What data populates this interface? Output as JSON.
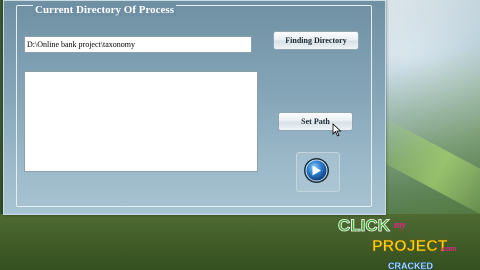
{
  "window": {
    "group_title": "Current Directory Of Process",
    "path_value": "D:\\Online bank project\\taxonomy",
    "find_button_label": "Finding Directory",
    "set_path_button_label": "Set Path",
    "output_text": ""
  },
  "logo": {
    "line1": "CLICK",
    "line1_small": "my",
    "line2": "PROJECT",
    "line2_small": ".com",
    "line3": "CRACKED"
  },
  "colors": {
    "logo_green": "#3aa12a",
    "logo_pink": "#e0268a",
    "logo_yellow": "#f2d21a",
    "arrow_blue": "#1b6fbf"
  },
  "icons": {
    "go": "arrow-right-icon",
    "cursor": "mouse-pointer-icon"
  }
}
